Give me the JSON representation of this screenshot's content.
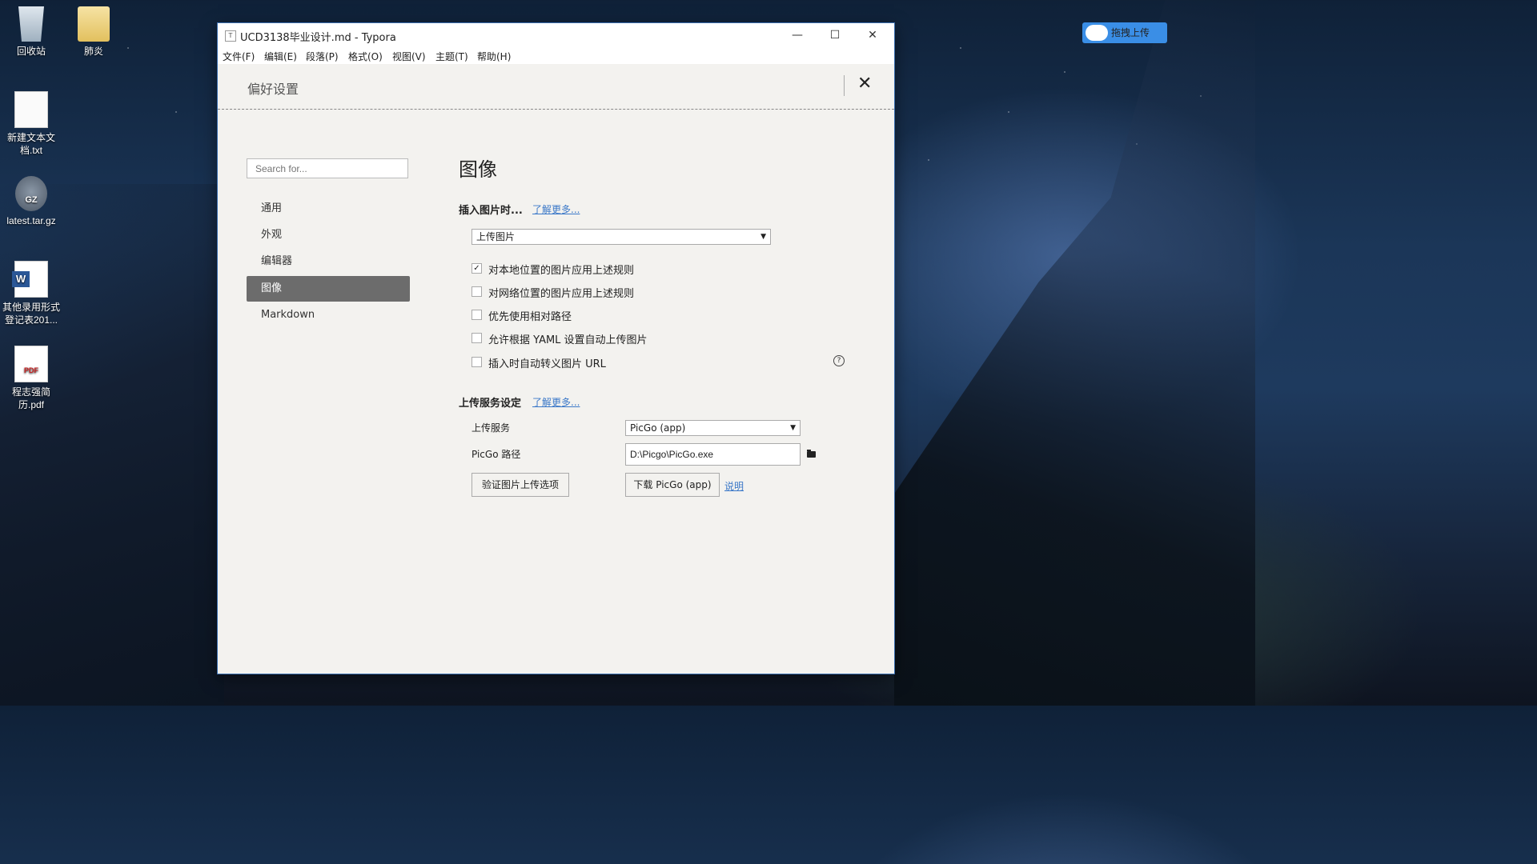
{
  "desktop": {
    "icons": [
      {
        "label": "回收站"
      },
      {
        "label": "肺炎"
      },
      {
        "label": "新建文本文档.txt"
      },
      {
        "label": "latest.tar.gz",
        "badge": "GZ"
      },
      {
        "label": "其他录用形式登记表201...",
        "badge": "W"
      },
      {
        "label": "程志强简历.pdf",
        "badge": "PDF"
      }
    ],
    "upload_widget": {
      "label": "拖拽上传"
    }
  },
  "window": {
    "app_icon": "T",
    "title": "UCD3138毕业设计.md - Typora",
    "controls": {
      "minimize": "—",
      "maximize": "☐",
      "close": "✕"
    },
    "menu": [
      "文件(F)",
      "编辑(E)",
      "段落(P)",
      "格式(O)",
      "视图(V)",
      "主题(T)",
      "帮助(H)"
    ]
  },
  "prefs": {
    "title": "偏好设置",
    "close": "✕",
    "search_placeholder": "Search for...",
    "nav": [
      "通用",
      "外观",
      "编辑器",
      "图像",
      "Markdown"
    ],
    "active_nav": "图像",
    "heading": "图像",
    "insert": {
      "title": "插入图片时...",
      "learn_more": "了解更多...",
      "action": "上传图片",
      "options": [
        {
          "label": "对本地位置的图片应用上述规则",
          "checked": true
        },
        {
          "label": "对网络位置的图片应用上述规则",
          "checked": false
        },
        {
          "label": "优先使用相对路径",
          "checked": false
        },
        {
          "label": "允许根据 YAML 设置自动上传图片",
          "checked": false
        },
        {
          "label": "插入时自动转义图片 URL",
          "checked": false
        }
      ],
      "help": "?"
    },
    "upload": {
      "title": "上传服务设定",
      "learn_more": "了解更多...",
      "service_label": "上传服务",
      "service_value": "PicGo (app)",
      "path_label": "PicGo 路径",
      "path_value": "D:\\Picgo\\PicGo.exe",
      "verify_button": "验证图片上传选项",
      "download_button": "下载 PicGo (app)",
      "help_link": "说明"
    }
  }
}
